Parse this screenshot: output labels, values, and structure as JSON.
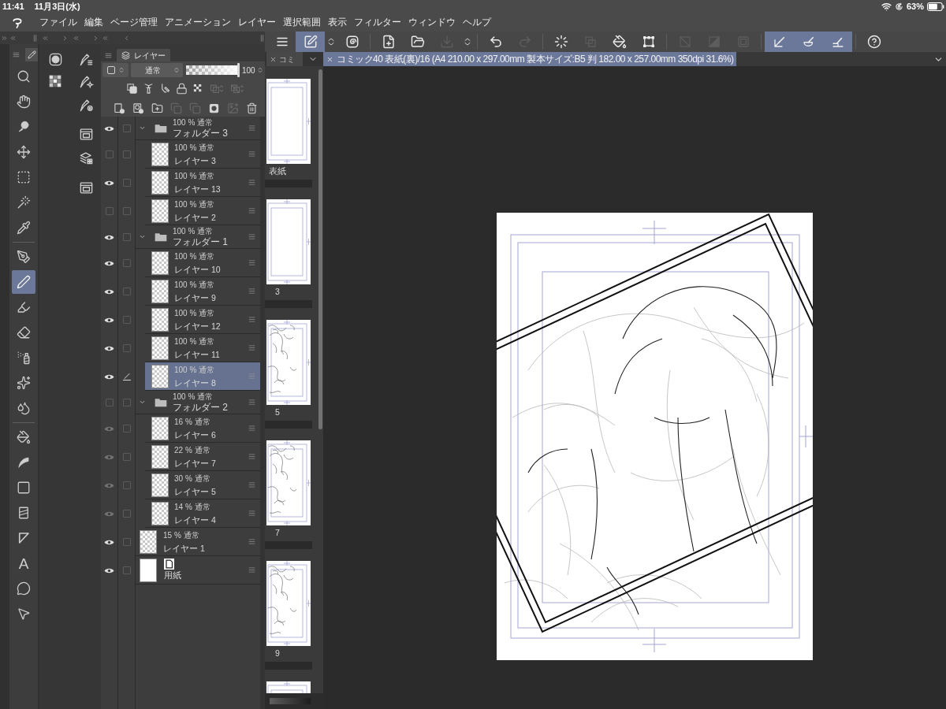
{
  "status_bar": {
    "time": "11:41",
    "date": "11月3日(水)",
    "battery": "63%"
  },
  "menu_bar": {
    "items": [
      "ファイル",
      "編集",
      "ページ管理",
      "アニメーション",
      "レイヤー",
      "選択範囲",
      "表示",
      "フィルター",
      "ウィンドウ",
      "ヘルプ"
    ]
  },
  "command_bar": {
    "groups": [
      [
        {
          "active": false,
          "disabled": false
        },
        {
          "active": true,
          "disabled": false
        },
        {
          "active": false,
          "disabled": false
        },
        {
          "active": false,
          "disabled": false
        }
      ],
      [
        {
          "active": false,
          "disabled": false
        },
        {
          "active": false,
          "disabled": false
        },
        {
          "active": false,
          "disabled": true
        },
        {
          "active": false,
          "disabled": false
        }
      ],
      [
        {
          "active": false,
          "disabled": false
        },
        {
          "active": false,
          "disabled": true
        }
      ],
      [
        {
          "active": false,
          "disabled": false
        },
        {
          "active": false,
          "disabled": true
        },
        {
          "active": false,
          "disabled": false
        },
        {
          "active": false,
          "disabled": false
        }
      ],
      [
        {
          "active": false,
          "disabled": true
        },
        {
          "active": false,
          "disabled": true
        },
        {
          "active": false,
          "disabled": true
        }
      ],
      [
        {
          "active": true,
          "disabled": false
        },
        {
          "active": true,
          "disabled": false
        },
        {
          "active": true,
          "disabled": false
        }
      ],
      [
        {
          "active": false,
          "disabled": false
        }
      ]
    ]
  },
  "tool_palette": {
    "tools": [
      {
        "selected": false
      },
      {
        "selected": false
      },
      {
        "selected": false
      },
      {
        "selected": false
      },
      {
        "selected": false
      },
      {
        "selected": false
      },
      {
        "selected": false
      },
      {
        "selected": false
      },
      {
        "selected": true
      },
      {
        "selected": false
      },
      {
        "selected": false
      },
      {
        "selected": false
      },
      {
        "selected": false
      },
      {
        "selected": false
      },
      {
        "selected": false
      },
      {
        "selected": false
      },
      {
        "selected": false
      },
      {
        "selected": false
      },
      {
        "selected": false
      },
      {
        "selected": false,
        "glyph": "A"
      },
      {
        "selected": false
      },
      {
        "selected": false
      }
    ]
  },
  "layer_panel": {
    "tab": "レイヤー",
    "blend_mode": "通常",
    "opacity": "100",
    "opacity_slider": {
      "level": 1
    },
    "tools_row_1": [
      {
        "disabled": false
      },
      {
        "disabled": false
      },
      {
        "disabled": false
      },
      {
        "disabled": false
      },
      {
        "disabled": false
      },
      {
        "disabled": true
      },
      {
        "disabled": true
      }
    ],
    "tools_row_2": [
      {
        "disabled": false
      },
      {
        "disabled": false
      },
      {
        "disabled": false
      },
      {
        "disabled": true
      },
      {
        "disabled": true
      },
      {
        "disabled": false
      },
      {
        "disabled": true
      },
      {
        "disabled": false
      }
    ],
    "layers": [
      {
        "kind": "folder",
        "properties": "100 % 通常",
        "name": "フォルダー 3",
        "visible": true,
        "editing": false,
        "selected": false,
        "expanded": true,
        "children": [
          {
            "kind": "layer",
            "properties": "100 % 通常",
            "name": "レイヤー 3",
            "visible": false,
            "editing": false,
            "selected": false
          },
          {
            "kind": "layer",
            "properties": "100 % 通常",
            "name": "レイヤー 13",
            "visible": true,
            "editing": false,
            "selected": false
          },
          {
            "kind": "layer",
            "properties": "100 % 通常",
            "name": "レイヤー 2",
            "visible": false,
            "editing": false,
            "selected": false
          }
        ]
      },
      {
        "kind": "folder",
        "properties": "100 % 通常",
        "name": "フォルダー 1",
        "visible": true,
        "editing": false,
        "selected": false,
        "expanded": true,
        "children": [
          {
            "kind": "layer",
            "properties": "100 % 通常",
            "name": "レイヤー 10",
            "visible": true,
            "editing": false,
            "selected": false
          },
          {
            "kind": "layer",
            "properties": "100 % 通常",
            "name": "レイヤー 9",
            "visible": true,
            "editing": false,
            "selected": false
          },
          {
            "kind": "layer",
            "properties": "100 % 通常",
            "name": "レイヤー 12",
            "visible": true,
            "editing": false,
            "selected": false
          },
          {
            "kind": "layer",
            "properties": "100 % 通常",
            "name": "レイヤー 11",
            "visible": true,
            "editing": false,
            "selected": false
          },
          {
            "kind": "layer",
            "properties": "100 % 通常",
            "name": "レイヤー 8",
            "visible": true,
            "editing": true,
            "selected": true
          }
        ]
      },
      {
        "kind": "folder",
        "properties": "100 % 通常",
        "name": "フォルダー 2",
        "visible": false,
        "editing": false,
        "selected": false,
        "expanded": true,
        "children": [
          {
            "kind": "layer",
            "properties": "16 % 通常",
            "name": "レイヤー 6",
            "visible": true,
            "editing": false,
            "selected": false
          },
          {
            "kind": "layer",
            "properties": "22 % 通常",
            "name": "レイヤー 7",
            "visible": true,
            "editing": false,
            "selected": false
          },
          {
            "kind": "layer",
            "properties": "30 % 通常",
            "name": "レイヤー 5",
            "visible": true,
            "editing": false,
            "selected": false
          },
          {
            "kind": "layer",
            "properties": "14 % 通常",
            "name": "レイヤー 4",
            "visible": true,
            "editing": false,
            "selected": false
          }
        ]
      },
      {
        "kind": "layer",
        "properties": "15 % 通常",
        "name": "レイヤー 1",
        "visible": true,
        "editing": false,
        "selected": false
      },
      {
        "kind": "paper",
        "name": "用紙",
        "visible": true,
        "editing": false,
        "selected": false
      }
    ]
  },
  "page_panel": {
    "tab": "コミ",
    "pages": [
      {
        "label": "表紙",
        "sketched": false
      },
      {
        "label": "3",
        "sketched": false
      },
      {
        "label": "5",
        "sketched": true
      },
      {
        "label": "7",
        "sketched": true
      },
      {
        "label": "9",
        "sketched": true
      },
      {
        "sketched": false
      }
    ]
  },
  "canvas": {
    "tab": "コミック40 表紙(裏)/16 (A4 210.00 x 297.00mm 製本サイズ:B5 判 182.00 x 257.00mm 350dpi 31.6%)"
  }
}
